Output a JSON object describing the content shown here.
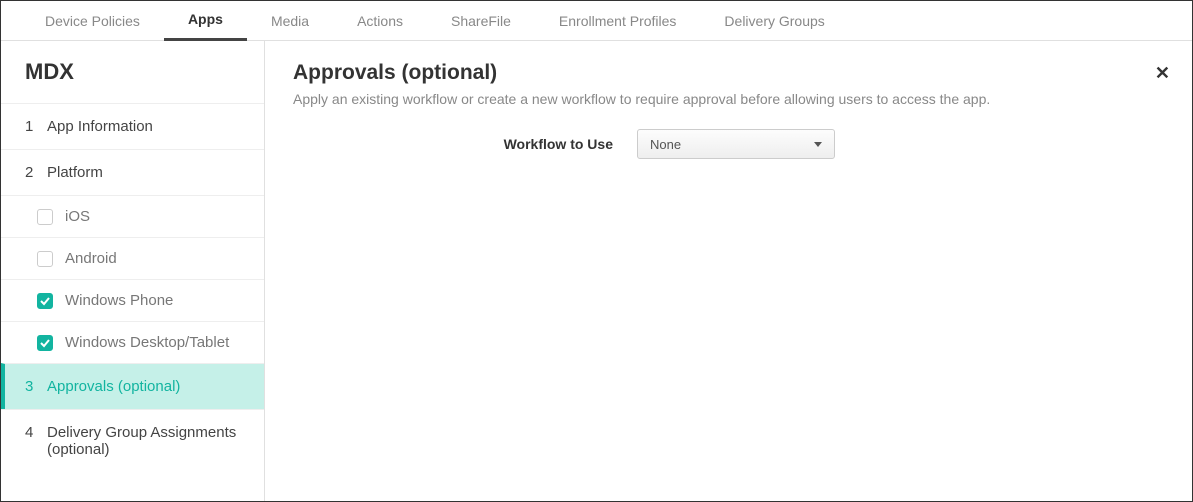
{
  "tabs": {
    "items": [
      "Device Policies",
      "Apps",
      "Media",
      "Actions",
      "ShareFile",
      "Enrollment Profiles",
      "Delivery Groups"
    ],
    "activeIndex": 1
  },
  "sidebar": {
    "title": "MDX",
    "steps": [
      {
        "num": "1",
        "label": "App Information"
      },
      {
        "num": "2",
        "label": "Platform"
      },
      {
        "num": "3",
        "label": "Approvals (optional)"
      },
      {
        "num": "4",
        "label": "Delivery Group Assignments (optional)"
      }
    ],
    "platforms": [
      {
        "label": "iOS",
        "checked": false
      },
      {
        "label": "Android",
        "checked": false
      },
      {
        "label": "Windows Phone",
        "checked": true
      },
      {
        "label": "Windows Desktop/Tablet",
        "checked": true
      }
    ],
    "selectedStepIndex": 2
  },
  "content": {
    "title": "Approvals (optional)",
    "description": "Apply an existing workflow or create a new workflow to require approval before allowing users to access the app.",
    "form": {
      "workflow_label": "Workflow to Use",
      "workflow_value": "None"
    }
  }
}
